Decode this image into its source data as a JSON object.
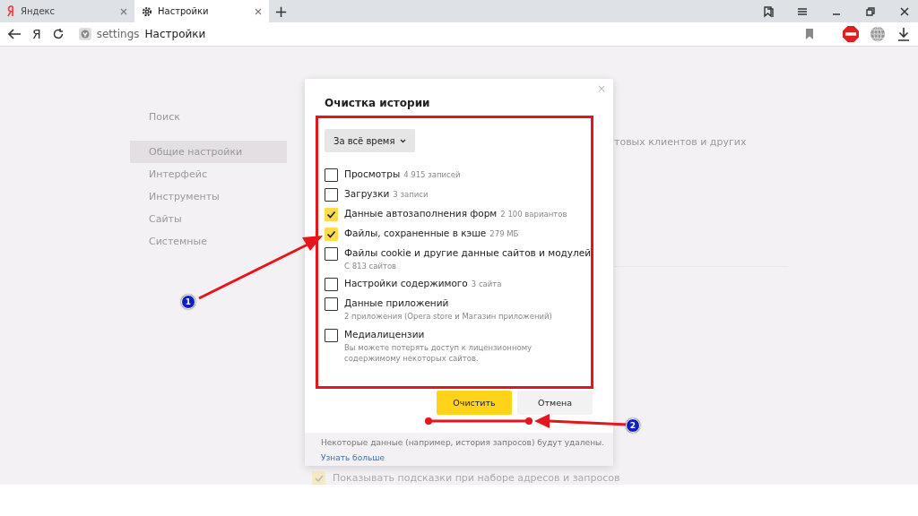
{
  "tabs": [
    {
      "label": "Яндекс",
      "selected": false
    },
    {
      "label": "Настройки",
      "selected": true
    }
  ],
  "new_tab": "+",
  "address_bar": {
    "logo": "Я",
    "scheme": "settings",
    "title": "Настройки"
  },
  "sidebar": {
    "search": "Поиск",
    "items": [
      {
        "label": "Общие настройки",
        "selected": true
      },
      {
        "label": "Интерфейс",
        "selected": false
      },
      {
        "label": "Инструменты",
        "selected": false
      },
      {
        "label": "Сайты",
        "selected": false
      },
      {
        "label": "Системные",
        "selected": false
      }
    ]
  },
  "background_text": "товых клиентов и других",
  "background_option": {
    "label": "Показывать подсказки при наборе адресов и запросов",
    "checked": true
  },
  "dialog": {
    "title": "Очистка истории",
    "close": "×",
    "period": "За всё время",
    "items": [
      {
        "label": "Просмотры",
        "count": "4 915 записей",
        "checked": false
      },
      {
        "label": "Загрузки",
        "count": "3 записи",
        "checked": false
      },
      {
        "label": "Данные автозаполнения форм",
        "count": "2 100 вариантов",
        "checked": true
      },
      {
        "label": "Файлы, сохраненные в кэше",
        "count": "279 МБ",
        "checked": true
      },
      {
        "label": "Файлы cookie и другие данные сайтов и модулей",
        "detail": "С 813 сайтов",
        "checked": false
      },
      {
        "label": "Настройки содержимого",
        "count": "3 сайта",
        "checked": false
      },
      {
        "label": "Данные приложений",
        "detail": "2 приложения (Opera store и Магазин приложений)",
        "checked": false
      },
      {
        "label": "Медиалицензии",
        "detail": "Вы можете потерять доступ к лицензионному содержимому некоторых сайтов.",
        "checked": false
      }
    ],
    "buttons": [
      {
        "label": "Очистить",
        "kind": "primary"
      },
      {
        "label": "Отмена",
        "kind": "secondary"
      }
    ],
    "footer_text": "Некоторые данные (например, история запросов) будут удалены.",
    "footer_link": "Узнать больше"
  },
  "annotations": [
    "1",
    "2"
  ]
}
